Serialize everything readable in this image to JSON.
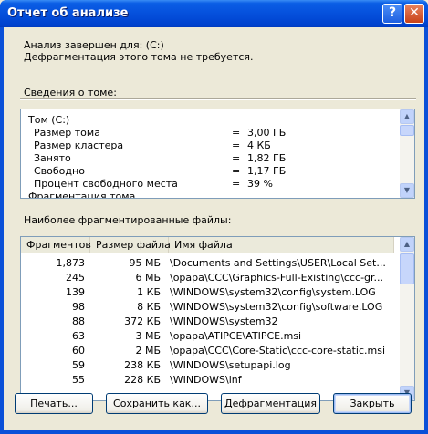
{
  "window": {
    "title": "Отчет об анализе"
  },
  "message": {
    "line1": "Анализ завершен для: (C:)",
    "line2": "Дефрагментация этого тома не требуется."
  },
  "volume_section": {
    "label": "Сведения о томе:",
    "root": "Том (C:)",
    "rows": [
      {
        "name": "Размер тома",
        "eq": "=",
        "value": "3,00 ГБ"
      },
      {
        "name": "Размер кластера",
        "eq": "=",
        "value": "4 КБ"
      },
      {
        "name": "Занято",
        "eq": "=",
        "value": "1,82 ГБ"
      },
      {
        "name": "Свободно",
        "eq": "=",
        "value": "1,17 ГБ"
      },
      {
        "name": "Процент свободного места",
        "eq": "=",
        "value": "39 %"
      }
    ],
    "last": "Фрагментация тома"
  },
  "files_section": {
    "label": "Наиболее фрагментированные файлы:",
    "headers": [
      "Фрагментов",
      "Размер файла",
      "Имя файла"
    ],
    "rows": [
      {
        "fragments": "1,873",
        "size": "95 МБ",
        "name": "\\Documents and Settings\\USER\\Local Set..."
      },
      {
        "fragments": "245",
        "size": "6 МБ",
        "name": "\\opapa\\CCC\\Graphics-Full-Existing\\ccc-gr..."
      },
      {
        "fragments": "139",
        "size": "1 КБ",
        "name": "\\WINDOWS\\system32\\config\\system.LOG"
      },
      {
        "fragments": "98",
        "size": "8 КБ",
        "name": "\\WINDOWS\\system32\\config\\software.LOG"
      },
      {
        "fragments": "88",
        "size": "372 КБ",
        "name": "\\WINDOWS\\system32"
      },
      {
        "fragments": "63",
        "size": "3 МБ",
        "name": "\\opapa\\ATIPCE\\ATIPCE.msi"
      },
      {
        "fragments": "60",
        "size": "2 МБ",
        "name": "\\opapa\\CCC\\Core-Static\\ccc-core-static.msi"
      },
      {
        "fragments": "59",
        "size": "238 КБ",
        "name": "\\WINDOWS\\setupapi.log"
      },
      {
        "fragments": "55",
        "size": "228 КБ",
        "name": "\\WINDOWS\\inf"
      }
    ]
  },
  "buttons": {
    "print": "Печать...",
    "save": "Сохранить как...",
    "defrag": "Дефрагментация",
    "close": "Закрыть"
  },
  "icons": [
    "help-icon",
    "close-icon",
    "scroll-up-icon",
    "scroll-down-icon"
  ]
}
